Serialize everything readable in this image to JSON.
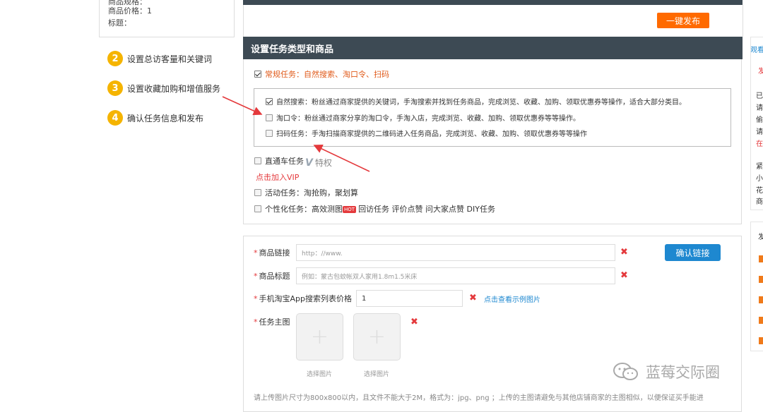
{
  "left_card": {
    "row1": "商品规格：",
    "price_label": "商品价格：1",
    "title_label": "标题："
  },
  "steps": [
    {
      "num": "2",
      "label": "设置总访客量和关键词"
    },
    {
      "num": "3",
      "label": "设置收藏加购和增值服务"
    },
    {
      "num": "4",
      "label": "确认任务信息和发布"
    }
  ],
  "publish_button": "一键发布",
  "section_title": "设置任务类型和商品",
  "task_types": {
    "regular": {
      "label": "常规任务：自然搜索、淘口令、扫码",
      "checked": true
    },
    "sub_options": [
      {
        "label": "自然搜索：粉丝通过商家提供的关键词，手淘搜索并找到任务商品，完成浏览、收藏、加购、领取优惠券等操作，适合大部分类目。",
        "checked": true
      },
      {
        "label": "淘口令：粉丝通过商家分享的淘口令，手淘入店，完成浏览、收藏、加购、领取优惠券等等操作。",
        "checked": false
      },
      {
        "label": "扫码任务：手淘扫描商家提供的二维码进入任务商品，完成浏览、收藏、加购、领取优惠券等等操作",
        "checked": false
      }
    ],
    "through_train": {
      "label": "直通车任务",
      "checked": false
    },
    "vip_badge": "特权",
    "vip_link": "点击加入VIP",
    "activity": {
      "label": "活动任务：淘抢购，聚划算",
      "checked": false
    },
    "personal": {
      "label": "个性化任务：高效测图",
      "hot": "HOT",
      "extras": "回访任务  评价点赞  问大家点赞  DIY任务",
      "checked": false
    }
  },
  "form": {
    "link_label": "商品链接",
    "link_placeholder": "http：//www.",
    "confirm_button": "确认链接",
    "title_label": "商品标题",
    "title_placeholder": "例如：蒙古包蚊帐双人家用1.8m1.5米床",
    "price_label": "手机淘宝App搜索列表价格",
    "price_value": "1",
    "example_link": "点击查看示例图片",
    "image_label": "任务主图",
    "upload_label_1": "选择图片",
    "upload_label_2": "选择图片",
    "note": "请上传图片尺寸为800x800以内，且文件不能大于2M，格式为：jpg、png ；上传的主图请避免与其他店铺商家的主图相似，以便保证买手能进"
  },
  "right_panel": {
    "top_link": "观看",
    "item_a": "发",
    "lines": [
      "已",
      "请",
      "偷",
      "请",
      "在",
      "紧",
      "小",
      "花",
      "商"
    ],
    "item_b": "发"
  },
  "watermark": "蓝莓交际圈",
  "colors": {
    "header_bg": "#3d4a54",
    "accent_orange": "#ff6a00",
    "accent_blue": "#1e88d0",
    "error_red": "#e4393c",
    "step_yellow": "#f5b400"
  }
}
